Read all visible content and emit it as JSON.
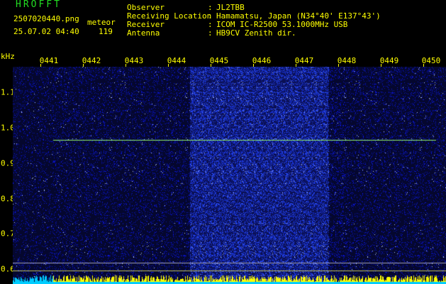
{
  "header": {
    "app_title": "HROFFT",
    "file_name": "2507020440.png",
    "timestamp": "25.07.02 04:40",
    "count_label": "meteor",
    "count_value": "119",
    "fields": [
      {
        "label": "Observer",
        "sep": ":",
        "value": "JL2TBB"
      },
      {
        "label": "Receiving Location",
        "sep": ":",
        "value": "Hamamatsu, Japan (N34°40' E137°43')"
      },
      {
        "label": "Receiver",
        "sep": ":",
        "value": "ICOM IC-R2500 53.1000MHz USB"
      },
      {
        "label": "Antenna",
        "sep": ":",
        "value": "HB9CV Zenith dir."
      }
    ]
  },
  "axes": {
    "y_unit": "kHz",
    "x_ticks": [
      "0441",
      "0442",
      "0443",
      "0444",
      "0445",
      "0446",
      "0447",
      "0448",
      "0449",
      "0450"
    ],
    "y_ticks": [
      "1.1",
      "1.0",
      "0.9",
      "0.8",
      "0.7",
      "0.6"
    ]
  },
  "colors": {
    "title_green": "#22dd22",
    "header_yellow": "#ffff00",
    "background": "#000000",
    "spectrum_base": "#05072e",
    "noise_bright": "#1a2cff",
    "trace_line": "#90ee70",
    "baseline_cyan": "#00ccff",
    "baseline_yellow": "#ffff00"
  },
  "signal": {
    "carrier_khz": 0.965,
    "bright_band_minutes": [
      "0444.1",
      "0447.5"
    ]
  }
}
